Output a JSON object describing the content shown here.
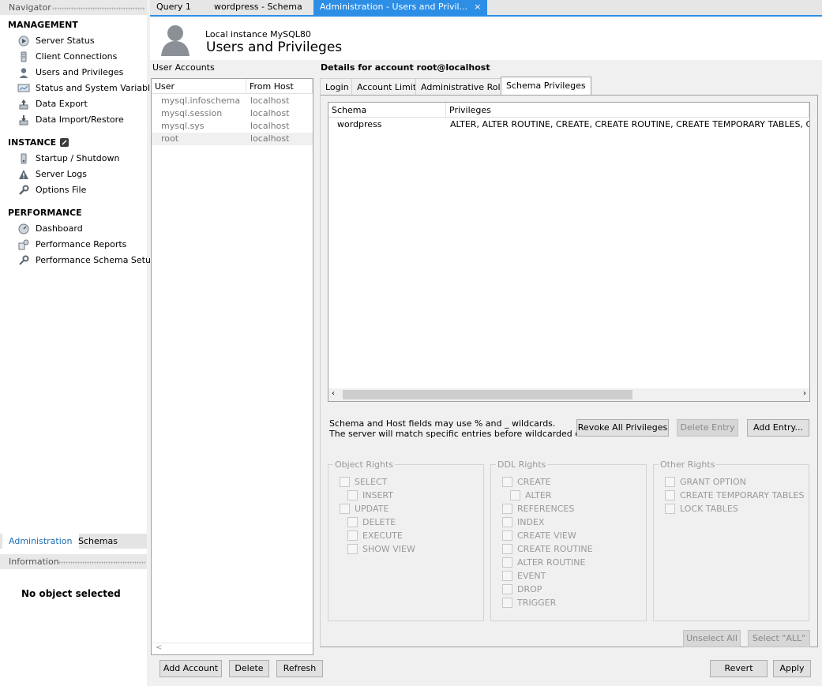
{
  "navigator": {
    "title": "Navigator",
    "management": {
      "label": "MANAGEMENT",
      "items": [
        {
          "label": "Server Status",
          "icon": "server-status-icon"
        },
        {
          "label": "Client Connections",
          "icon": "client-connections-icon"
        },
        {
          "label": "Users and Privileges",
          "icon": "user-icon"
        },
        {
          "label": "Status and System Variables",
          "icon": "monitor-icon"
        },
        {
          "label": "Data Export",
          "icon": "export-icon"
        },
        {
          "label": "Data Import/Restore",
          "icon": "import-icon"
        }
      ]
    },
    "instance": {
      "label": "INSTANCE",
      "items": [
        {
          "label": "Startup / Shutdown",
          "icon": "power-icon"
        },
        {
          "label": "Server Logs",
          "icon": "warning-icon"
        },
        {
          "label": "Options File",
          "icon": "wrench-icon"
        }
      ]
    },
    "performance": {
      "label": "PERFORMANCE",
      "items": [
        {
          "label": "Dashboard",
          "icon": "dashboard-icon"
        },
        {
          "label": "Performance Reports",
          "icon": "reports-icon"
        },
        {
          "label": "Performance Schema Setup",
          "icon": "wrench-gear-icon"
        }
      ]
    },
    "tabs": [
      "Administration",
      "Schemas"
    ],
    "info_title": "Information",
    "info_text": "No object selected"
  },
  "doc_tabs": [
    {
      "label": "Query 1"
    },
    {
      "label": "wordpress - Schema"
    },
    {
      "label": "Administration - Users and Privil...",
      "close": "×"
    }
  ],
  "header": {
    "instance": "Local instance MySQL80",
    "title": "Users and Privileges"
  },
  "user_accounts": {
    "label": "User Accounts",
    "columns": [
      "User",
      "From Host"
    ],
    "rows": [
      {
        "user": "mysql.infoschema",
        "host": "localhost"
      },
      {
        "user": "mysql.session",
        "host": "localhost"
      },
      {
        "user": "mysql.sys",
        "host": "localhost"
      },
      {
        "user": "root",
        "host": "localhost"
      }
    ],
    "scroll_left": "<"
  },
  "details": {
    "title": "Details for account root@localhost",
    "tabs": [
      "Login",
      "Account Limits",
      "Administrative Roles",
      "Schema Privileges"
    ],
    "schema_columns": [
      "Schema",
      "Privileges"
    ],
    "schema_rows": [
      {
        "schema": "wordpress",
        "privileges": "ALTER, ALTER ROUTINE, CREATE, CREATE ROUTINE, CREATE TEMPORARY TABLES, CREA"
      }
    ],
    "hint_line1": "Schema and Host fields may use % and _ wildcards.",
    "hint_line2": "The server will match specific entries before wildcarded ones.",
    "buttons": {
      "revoke": "Revoke All Privileges",
      "delete_entry": "Delete Entry",
      "add_entry": "Add Entry...",
      "unselect_all": "Unselect All",
      "select_all": "Select \"ALL\""
    },
    "object_rights": {
      "label": "Object Rights",
      "items": [
        "SELECT",
        "INSERT",
        "UPDATE",
        "DELETE",
        "EXECUTE",
        "SHOW VIEW"
      ]
    },
    "ddl_rights": {
      "label": "DDL Rights",
      "items": [
        "CREATE",
        "ALTER",
        "REFERENCES",
        "INDEX",
        "CREATE VIEW",
        "CREATE ROUTINE",
        "ALTER ROUTINE",
        "EVENT",
        "DROP",
        "TRIGGER"
      ]
    },
    "other_rights": {
      "label": "Other Rights",
      "items": [
        "GRANT OPTION",
        "CREATE TEMPORARY TABLES",
        "LOCK TABLES"
      ]
    }
  },
  "bottom_buttons": {
    "add_account": "Add Account",
    "delete": "Delete",
    "refresh": "Refresh",
    "revert": "Revert",
    "apply": "Apply"
  }
}
